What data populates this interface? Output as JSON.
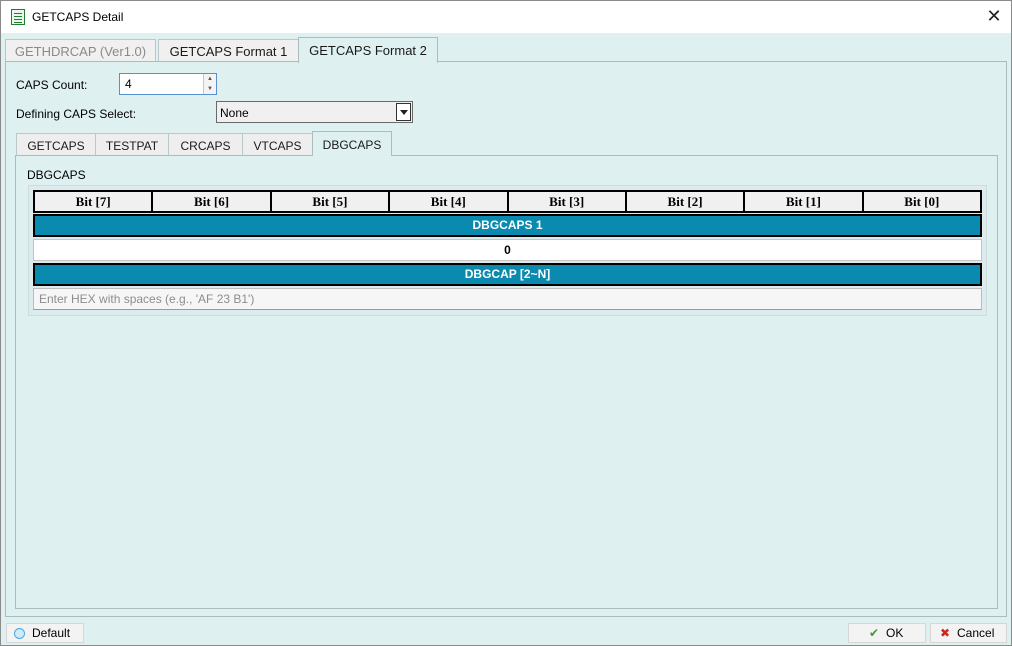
{
  "window": {
    "title": "GETCAPS Detail",
    "close_glyph": "✕",
    "icon": "document-icon"
  },
  "outer_tabs": [
    {
      "label": "GETHDRCAP (Ver1.0)",
      "state": "disabled"
    },
    {
      "label": "GETCAPS Format 1",
      "state": "normal"
    },
    {
      "label": "GETCAPS Format 2",
      "state": "selected"
    }
  ],
  "form": {
    "caps_count_label": "CAPS Count:",
    "caps_count_value": "4",
    "defining_caps_label": "Defining CAPS Select:",
    "defining_caps_value": "None"
  },
  "inner_tabs": [
    {
      "label": "GETCAPS",
      "state": "normal"
    },
    {
      "label": "TESTPAT",
      "state": "normal"
    },
    {
      "label": "CRCAPS",
      "state": "normal"
    },
    {
      "label": "VTCAPS",
      "state": "normal"
    },
    {
      "label": "DBGCAPS",
      "state": "selected"
    }
  ],
  "dbgcaps": {
    "group_label": "DBGCAPS",
    "bits": [
      "Bit [7]",
      "Bit [6]",
      "Bit [5]",
      "Bit [4]",
      "Bit [3]",
      "Bit [2]",
      "Bit [1]",
      "Bit [0]"
    ],
    "section1_title": "DBGCAPS 1",
    "section1_value": "0",
    "section2_title": "DBGCAP [2~N]",
    "hex_placeholder": "Enter HEX with spaces (e.g., 'AF 23 B1')",
    "hex_value": ""
  },
  "footer": {
    "default_label": "Default",
    "ok_label": "OK",
    "ok_icon": "checkmark-icon",
    "cancel_label": "Cancel",
    "cancel_icon": "x-mark-icon"
  },
  "colors": {
    "panel_bg": "#dff0f1",
    "header_bar": "#0a8aae",
    "ok_green": "#3f9b2f",
    "cancel_red": "#d3261f"
  }
}
